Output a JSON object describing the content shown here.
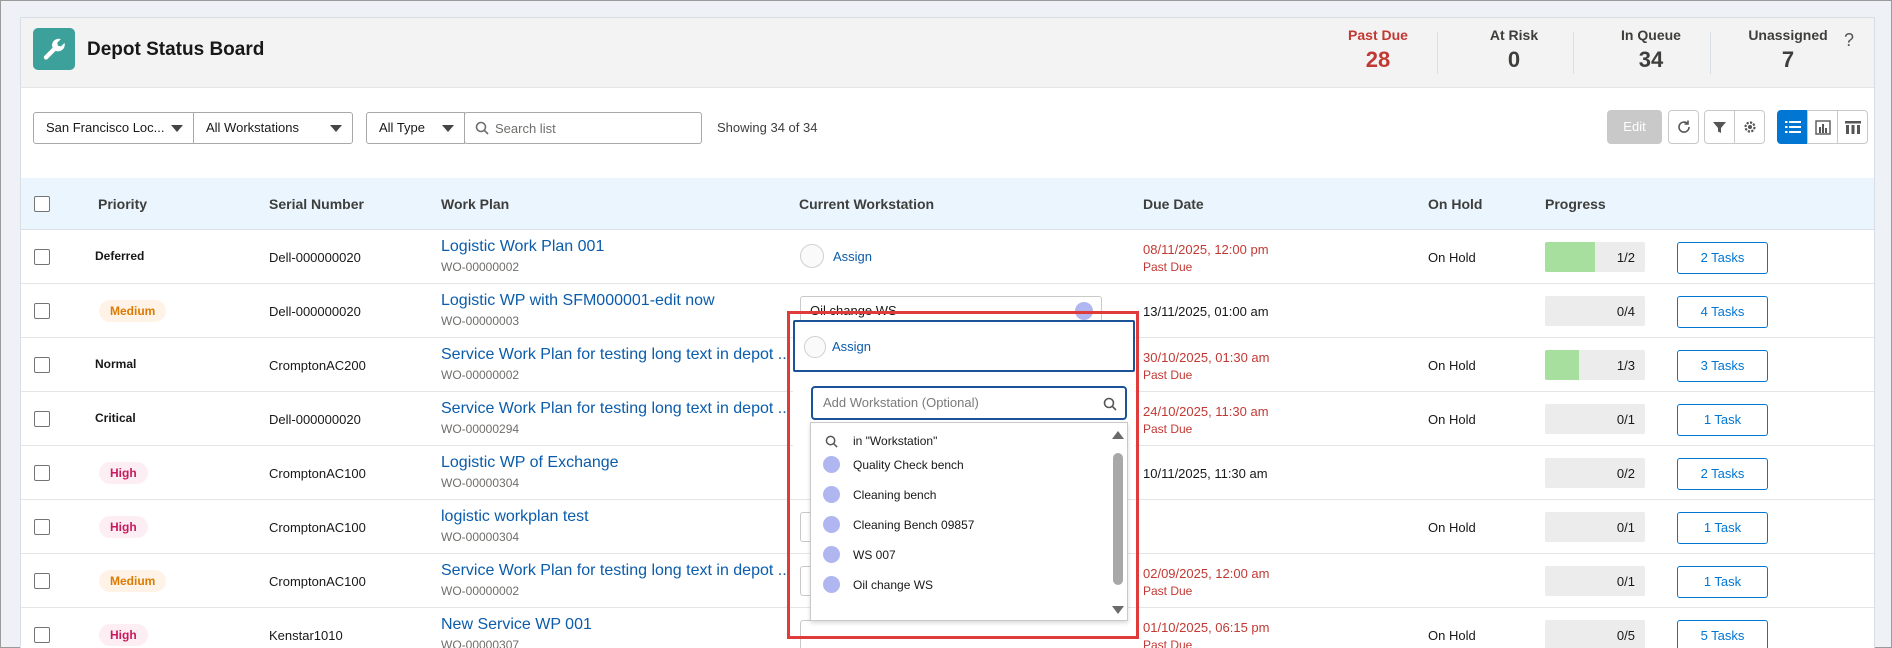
{
  "header": {
    "title": "Depot Status Board",
    "help": "?",
    "stats": [
      {
        "label": "Past Due",
        "value": "28",
        "color": "#c23934"
      },
      {
        "label": "At Risk",
        "value": "0"
      },
      {
        "label": "In Queue",
        "value": "34"
      },
      {
        "label": "Unassigned",
        "value": "7"
      }
    ]
  },
  "toolbar": {
    "location_select": "San Francisco Loc...",
    "workstation_select": "All Workstations",
    "type_select": "All Type",
    "search_placeholder": "Search list",
    "showing": "Showing 34 of 34",
    "edit_label": "Edit"
  },
  "table": {
    "headers": [
      "Priority",
      "Serial Number",
      "Work Plan",
      "Current Workstation",
      "Due Date",
      "On Hold",
      "Progress"
    ],
    "rows": [
      {
        "priority": "Deferred",
        "priority_style": "plain",
        "serial": "Dell-000000020",
        "work_plan": "Logistic Work Plan 001",
        "work_order": "WO-00000002",
        "workstation": "Assign",
        "ws_type": "assign",
        "due": "08/11/2025, 12:00 pm",
        "due_status": "Past Due",
        "on_hold": "On Hold",
        "progress": "1/2",
        "progress_fraction": 0.5,
        "tasks": "2 Tasks"
      },
      {
        "priority": "Medium",
        "priority_style": "medium",
        "serial": "Dell-000000020",
        "work_plan": "Logistic WP with SFM000001-edit now",
        "work_order": "WO-00000003",
        "workstation": "Oil change WS",
        "ws_type": "box",
        "due": "13/11/2025, 01:00 am",
        "due_status": "",
        "on_hold": "",
        "progress": "0/4",
        "progress_fraction": 0,
        "tasks": "4 Tasks"
      },
      {
        "priority": "Normal",
        "priority_style": "plain",
        "serial": "CromptonAC200",
        "work_plan": "Service Work Plan for testing long text in depot ...",
        "work_order": "WO-00000002",
        "workstation": "",
        "ws_type": "none",
        "due": "30/10/2025, 01:30 am",
        "due_status": "Past Due",
        "on_hold": "On Hold",
        "progress": "1/3",
        "progress_fraction": 0.333,
        "tasks": "3 Tasks"
      },
      {
        "priority": "Critical",
        "priority_style": "plain",
        "serial": "Dell-000000020",
        "work_plan": "Service Work Plan for testing long text in depot ...",
        "work_order": "WO-00000294",
        "workstation": "",
        "ws_type": "none",
        "due": "24/10/2025, 11:30 am",
        "due_status": "Past Due",
        "on_hold": "On Hold",
        "progress": "0/1",
        "progress_fraction": 0,
        "tasks": "1 Task"
      },
      {
        "priority": "High",
        "priority_style": "high",
        "serial": "CromptonAC100",
        "work_plan": "Logistic WP of Exchange",
        "work_order": "WO-00000304",
        "workstation": "",
        "ws_type": "none",
        "due": "10/11/2025, 11:30 am",
        "due_status": "",
        "on_hold": "",
        "progress": "0/2",
        "progress_fraction": 0,
        "tasks": "2 Tasks"
      },
      {
        "priority": "High",
        "priority_style": "high",
        "serial": "CromptonAC100",
        "work_plan": "logistic workplan test",
        "work_order": "WO-00000304",
        "workstation": "",
        "ws_type": "edge",
        "due": "",
        "due_status": "",
        "on_hold": "On Hold",
        "progress": "0/1",
        "progress_fraction": 0,
        "tasks": "1 Task"
      },
      {
        "priority": "Medium",
        "priority_style": "medium",
        "serial": "CromptonAC100",
        "work_plan": "Service Work Plan for testing long text in depot ...",
        "work_order": "WO-00000002",
        "workstation": "",
        "ws_type": "edge",
        "due": "02/09/2025, 12:00 am",
        "due_status": "Past Due",
        "on_hold": "",
        "progress": "0/1",
        "progress_fraction": 0,
        "tasks": "1 Task"
      },
      {
        "priority": "High",
        "priority_style": "high",
        "serial": "Kenstar1010",
        "work_plan": "New Service WP 001",
        "work_order": "WO-00000307",
        "workstation": "",
        "ws_type": "edge",
        "due": "01/10/2025, 06:15 pm",
        "due_status": "Past Due",
        "on_hold": "On Hold",
        "progress": "0/5",
        "progress_fraction": 0,
        "tasks": "5 Tasks"
      }
    ]
  },
  "popup": {
    "assign_label": "Assign",
    "search_placeholder": "Add Workstation (Optional)",
    "search_scope": "in \"Workstation\"",
    "options": [
      "Quality Check bench",
      "Cleaning bench",
      "Cleaning Bench 09857",
      "WS 007",
      "Oil change WS"
    ]
  },
  "colors": {
    "accent": "#0176d3",
    "past_due": "#c23934",
    "app_icon": "#3ba19a",
    "highlight": "#e03b3b"
  }
}
